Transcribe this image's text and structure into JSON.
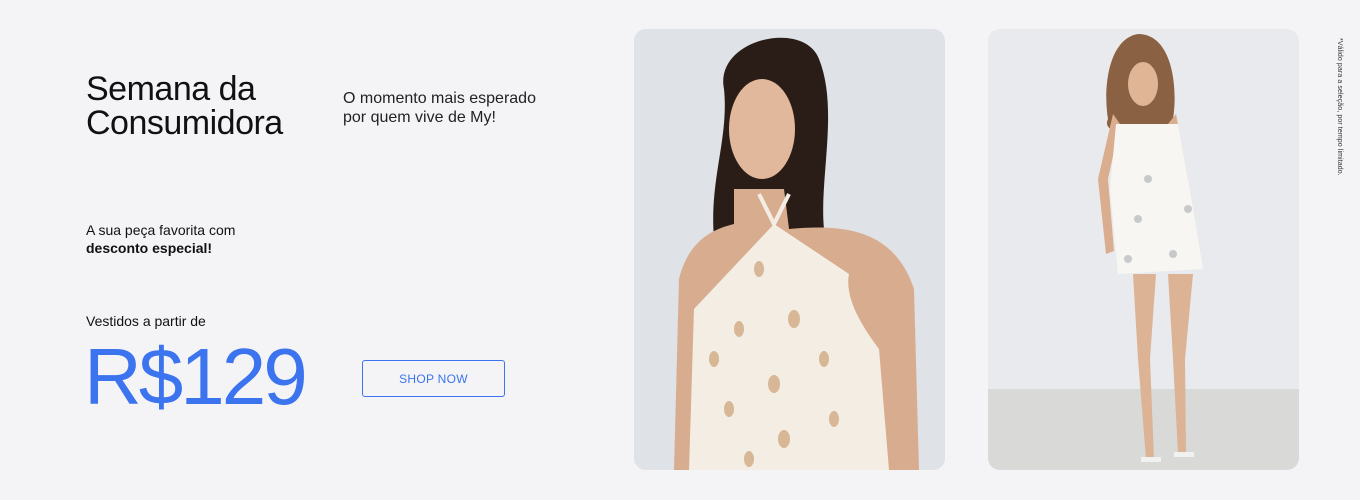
{
  "hero": {
    "title_line1": "Semana da",
    "title_line2": "Consumidora",
    "tagline_line1": "O momento mais esperado",
    "tagline_line2": "por quem vive de My!",
    "discount_line1": "A sua peça favorita com",
    "discount_line2": "desconto especial!",
    "price_prefix": "Vestidos a partir de",
    "price": "R$129",
    "cta_label": "SHOP NOW",
    "disclaimer": "*Válido para a seleção, por tempo limitado."
  },
  "colors": {
    "accent": "#3b74ee",
    "background": "#f4f4f7"
  },
  "images": [
    {
      "name": "model-halter-dress-photo"
    },
    {
      "name": "model-strap-mini-dress-photo"
    }
  ]
}
